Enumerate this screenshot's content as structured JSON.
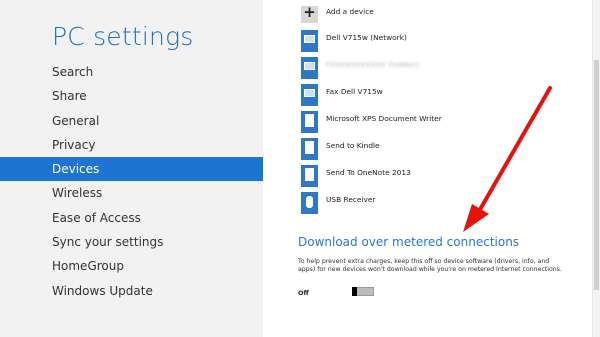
{
  "sidebar": {
    "title": "PC settings",
    "items": [
      {
        "label": "Search"
      },
      {
        "label": "Share"
      },
      {
        "label": "General"
      },
      {
        "label": "Privacy"
      },
      {
        "label": "Devices",
        "selected": true
      },
      {
        "label": "Wireless"
      },
      {
        "label": "Ease of Access"
      },
      {
        "label": "Sync your settings"
      },
      {
        "label": "HomeGroup"
      },
      {
        "label": "Windows Update"
      }
    ]
  },
  "devices": {
    "add_label": "Add a device",
    "items": [
      {
        "label": "Dell V715w (Network)",
        "icon": "printer-icon"
      },
      {
        "label": "F0XXXXXXXXXX (hidden)",
        "icon": "printer-icon"
      },
      {
        "label": "Fax Dell V715w",
        "icon": "fax-icon"
      },
      {
        "label": "Microsoft XPS Document Writer",
        "icon": "document-printer-icon"
      },
      {
        "label": "Send to Kindle",
        "icon": "document-printer-icon"
      },
      {
        "label": "Send To OneNote 2013",
        "icon": "document-printer-icon"
      },
      {
        "label": "USB Receiver",
        "icon": "mouse-icon"
      }
    ]
  },
  "metered": {
    "heading": "Download over metered connections",
    "description": "To help prevent extra charges, keep this off so device software (drivers, info, and apps) for new devices won't download while you're on metered Internet connections.",
    "toggle_state": "Off",
    "toggle_on": false
  },
  "colors": {
    "accent": "#1e75d1",
    "arrow": "#e8120c"
  }
}
